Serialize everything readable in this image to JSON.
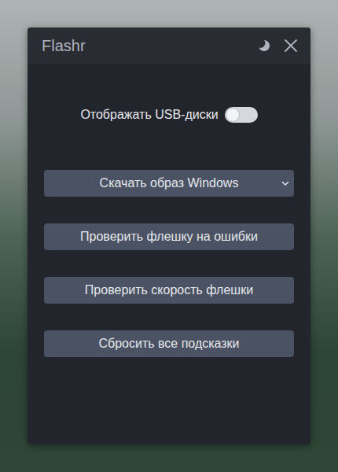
{
  "window": {
    "title": "Flashr"
  },
  "toggle": {
    "label": "Отображать USB-диски",
    "on": false
  },
  "dropdown": {
    "label": "Скачать образ Windows",
    "expanded": false
  },
  "buttons": [
    "Проверить флешку на ошибки",
    "Проверить скорость флешки",
    "Сбросить все подсказки"
  ]
}
